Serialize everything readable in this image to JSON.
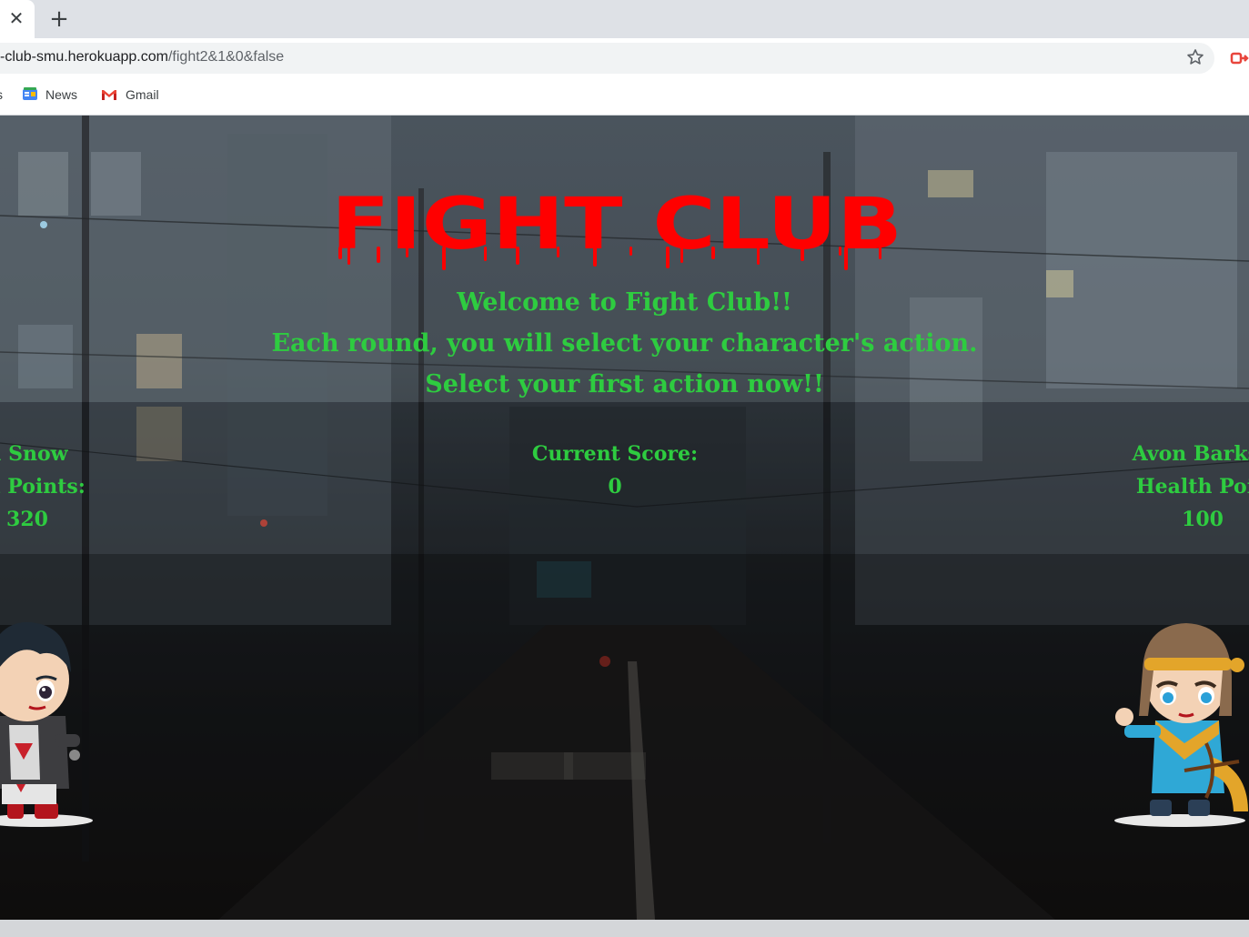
{
  "browser": {
    "tab_close_icon": "close-icon",
    "new_tab_icon": "plus-icon",
    "url_host": "-club-smu.herokuapp.com",
    "url_path": "/fight2&1&0&false",
    "bookmarks": [
      {
        "label": "s",
        "icon": "none"
      },
      {
        "label": "News",
        "icon": "google-news-icon"
      },
      {
        "label": "Gmail",
        "icon": "gmail-icon"
      }
    ]
  },
  "page": {
    "title": "FIGHT CLUB",
    "title_color": "#ff0000",
    "text_color": "#2ecc40",
    "intro_lines": [
      "Welcome to Fight Club!!",
      "Each round, you will select your character's action.",
      "Select your first action now!!"
    ],
    "player": {
      "name": "n Snow",
      "hp_label": "lth Points:",
      "hp_value": "320"
    },
    "score": {
      "label": "Current Score:",
      "value": "0"
    },
    "enemy": {
      "name": "Avon Barksd",
      "hp_label": "Health Poin",
      "hp_value": "100"
    }
  }
}
